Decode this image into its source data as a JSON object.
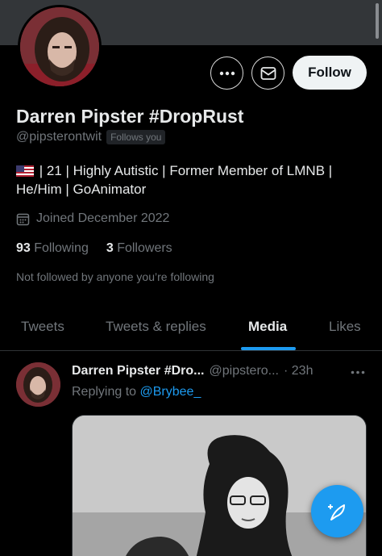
{
  "colors": {
    "accent": "#1d9bf0",
    "background": "#000000",
    "text_primary": "#e7e9ea",
    "text_secondary": "#71767b"
  },
  "profile": {
    "display_name": "Darren Pipster #DropRust",
    "handle": "@pipsterontwit",
    "follows_you_badge": "Follows you",
    "bio_line1": "| 21 | Highly Autistic | Former Member of LMNB |",
    "bio_line2": "He/Him | GoAnimator",
    "bio_flag_icon": "us-flag-icon",
    "joined": "Joined December 2022",
    "following_count": "93",
    "following_label": "Following",
    "followers_count": "3",
    "followers_label": "Followers",
    "not_followed_text": "Not followed by anyone you’re following"
  },
  "actions": {
    "more_icon": "more-horizontal-icon",
    "message_icon": "envelope-icon",
    "follow_label": "Follow"
  },
  "tabs": [
    {
      "label": "Tweets",
      "active": false
    },
    {
      "label": "Tweets & replies",
      "active": false
    },
    {
      "label": "Media",
      "active": true
    },
    {
      "label": "Likes",
      "active": false
    }
  ],
  "tweet": {
    "name": "Darren Pipster #Dro...",
    "handle": "@pipstero...",
    "time": "· 23h",
    "replying_prefix": "Replying to",
    "replying_to": "@Brybee_",
    "more_icon": "more-horizontal-icon"
  },
  "fab": {
    "icon": "compose-tweet-icon"
  }
}
